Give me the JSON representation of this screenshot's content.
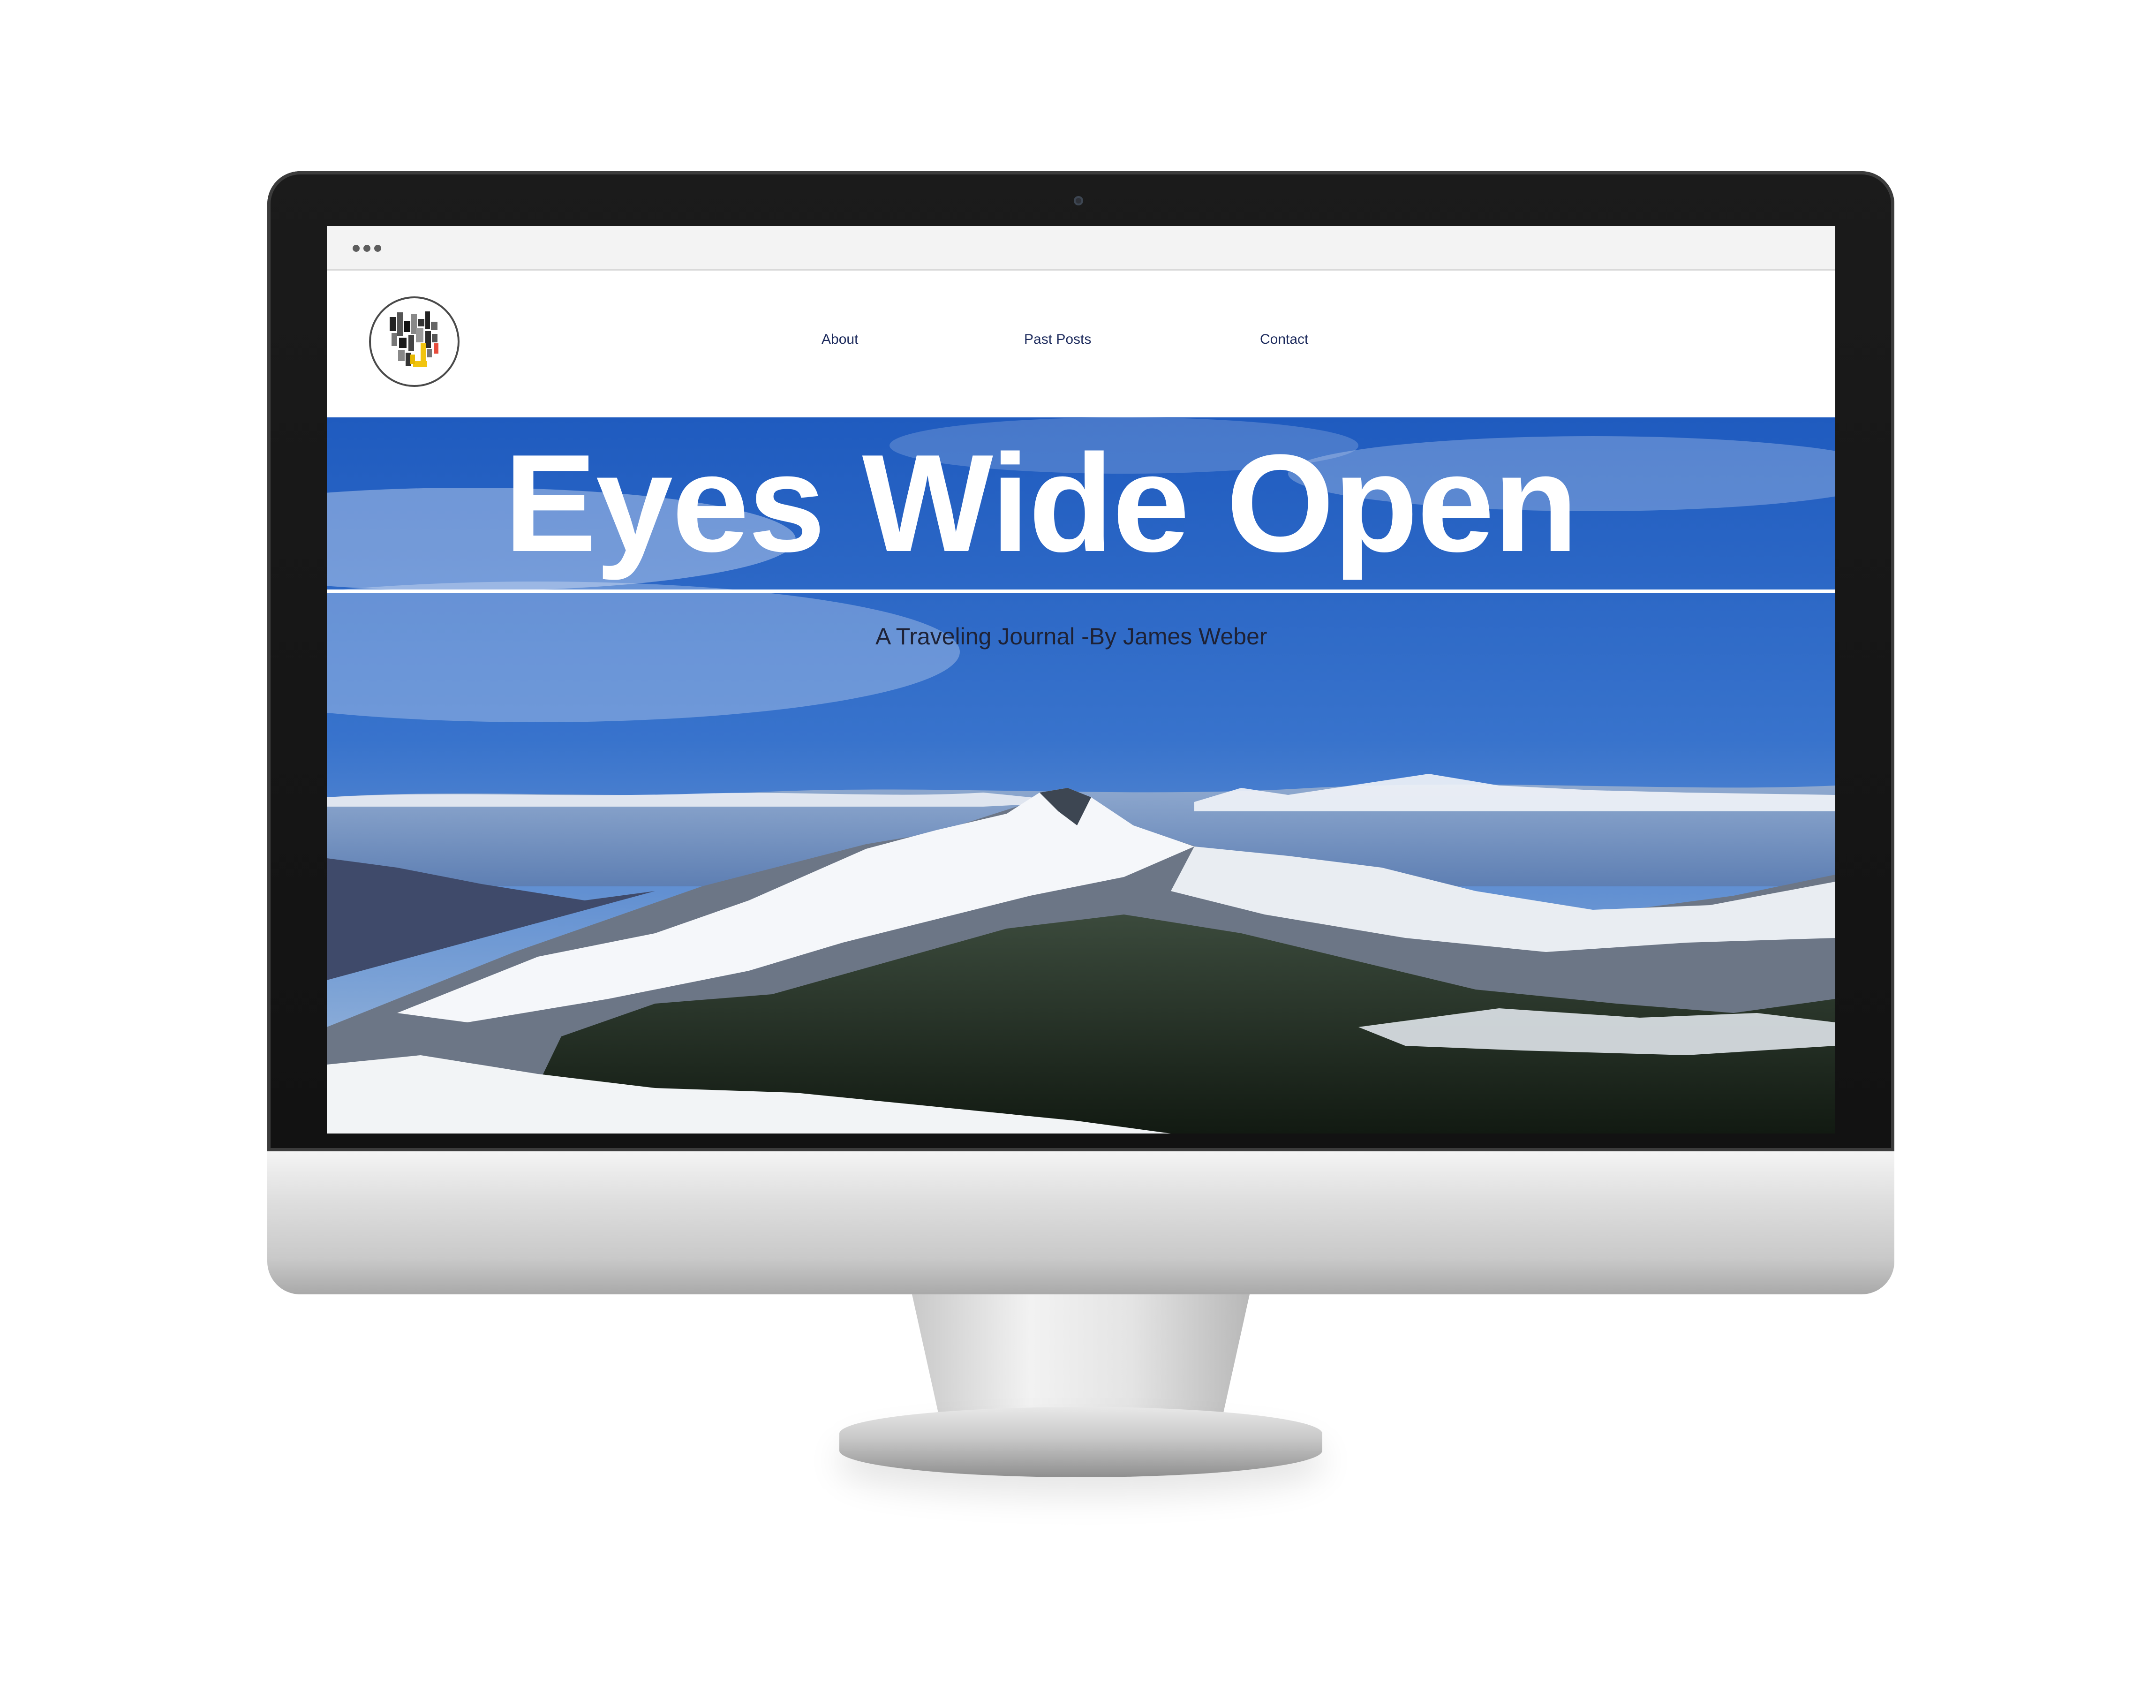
{
  "window": {
    "menu_icon": "ellipsis-icon"
  },
  "header": {
    "logo_icon": "pixel-monogram-logo",
    "nav": [
      {
        "label": "About"
      },
      {
        "label": "Past Posts"
      },
      {
        "label": "Contact"
      }
    ]
  },
  "hero": {
    "title": "Eyes Wide Open",
    "subtitle": "A Traveling Journal -By James Weber",
    "background_image": "snow-capped-mountains-under-blue-sky"
  },
  "colors": {
    "nav_text": "#1c2a5c",
    "title_text": "#ffffff",
    "subtitle_text": "#1e2236",
    "sky": "#2f66c0"
  }
}
